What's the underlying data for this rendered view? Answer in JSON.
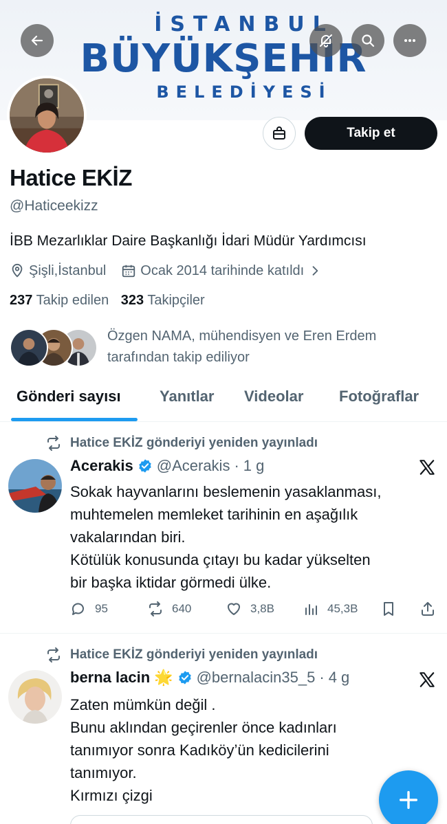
{
  "banner": {
    "line1": "İSTANBUL",
    "line2": "BÜYÜKŞEHİR",
    "line3": "BELEDİYESİ",
    "color": "#1d56a4"
  },
  "top_actions": {
    "back_icon": "arrow-left-icon",
    "mute_icon": "bell-off-icon",
    "search_icon": "search-icon",
    "more_icon": "more-horizontal-icon"
  },
  "profile": {
    "display_name": "Hatice EKİZ",
    "handle": "@Haticeekizz",
    "bio": "İBB Mezarlıklar Daire Başkanlığı İdari Müdür Yardımcısı",
    "location": "Şişli,İstanbul",
    "joined": "Ocak 2014 tarihinde katıldı",
    "following_count": "237",
    "following_label": "Takip edilen",
    "followers_count": "323",
    "followers_label": "Takipçiler",
    "followed_by_line1": "Özgen NAMA, mühendisyen ve Eren Erdem",
    "followed_by_line2": "tarafından takip ediliyor",
    "follow_button": "Takip et"
  },
  "tabs": [
    "Gönderi sayısı",
    "Yanıtlar",
    "Videolar",
    "Fotoğraflar"
  ],
  "posts": [
    {
      "repost_label": "Hatice EKİZ gönderiyi yeniden yayınladı",
      "name": "Acerakis",
      "handle": "@Acerakis",
      "time": "1 g",
      "lines": [
        "Sokak hayvanlarını beslemenin yasaklanması,",
        "muhtemelen memleket tarihinin en aşağılık",
        "vakalarından biri.",
        "Kötülük konusunda çıtayı bu kadar yükselten",
        "bir başka iktidar görmedi ülke."
      ],
      "replies": "95",
      "reposts": "640",
      "likes": "3,8B",
      "views": "45,3B"
    },
    {
      "repost_label": "Hatice EKİZ gönderiyi yeniden yayınladı",
      "name": "berna lacin",
      "emoji": "🌟",
      "handle": "@bernalacin35_5",
      "time": "4 g",
      "lines": [
        "Zaten mümkün değil .",
        "Bunu aklından geçirenler önce kadınları",
        "tanımıyor sonra Kadıköy’ün kedicilerini",
        "tanımıyor.",
        "Kırmızı çizgi"
      ]
    }
  ],
  "colors": {
    "accent": "#1d9bf0",
    "text_primary": "#0f1419",
    "text_secondary": "#536471"
  }
}
